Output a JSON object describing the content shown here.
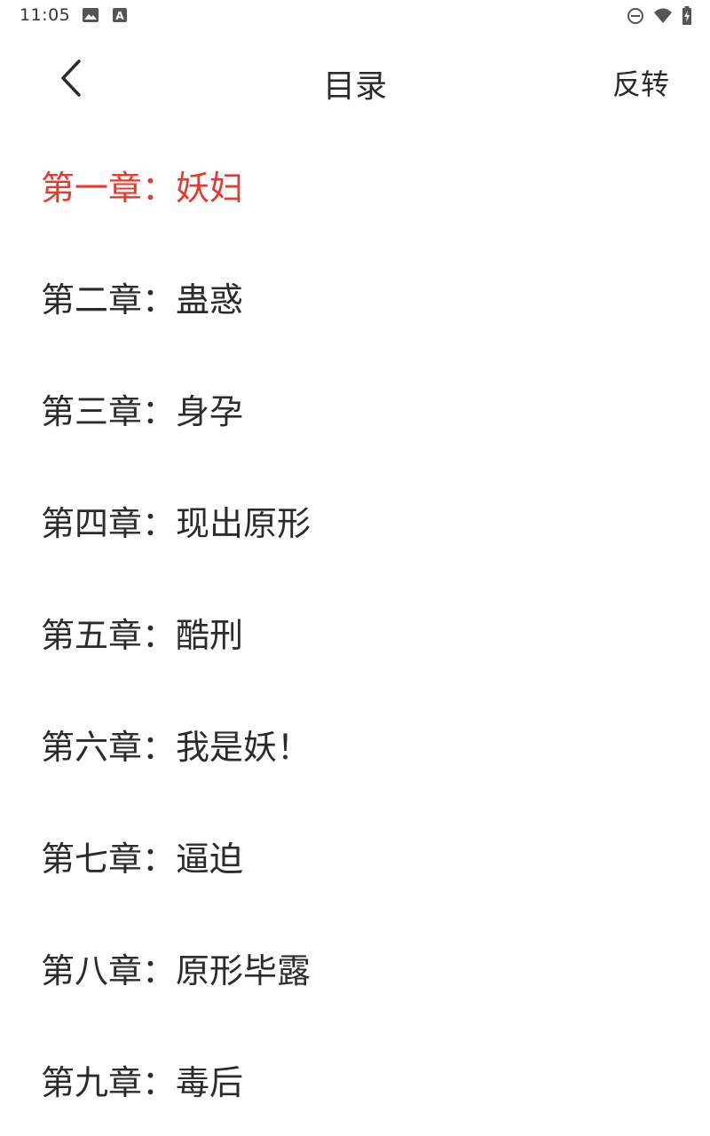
{
  "status_bar": {
    "time": "11:05",
    "left_icons": [
      "image-icon",
      "font-a-icon"
    ],
    "right_icons": [
      "dnd-icon",
      "wifi-icon",
      "battery-charging-icon"
    ]
  },
  "toolbar": {
    "back_icon": "chevron-left-icon",
    "title": "目录",
    "reverse_label": "反转"
  },
  "colors": {
    "active_chapter": "#e8392e",
    "text": "#2b2b2b",
    "background": "#ffffff"
  },
  "chapters": [
    {
      "label": "第一章：妖妇",
      "active": true
    },
    {
      "label": "第二章：蛊惑",
      "active": false
    },
    {
      "label": "第三章：身孕",
      "active": false
    },
    {
      "label": "第四章：现出原形",
      "active": false
    },
    {
      "label": "第五章：酷刑",
      "active": false
    },
    {
      "label": "第六章：我是妖！",
      "active": false
    },
    {
      "label": "第七章：逼迫",
      "active": false
    },
    {
      "label": "第八章：原形毕露",
      "active": false
    },
    {
      "label": "第九章：毒后",
      "active": false
    }
  ]
}
